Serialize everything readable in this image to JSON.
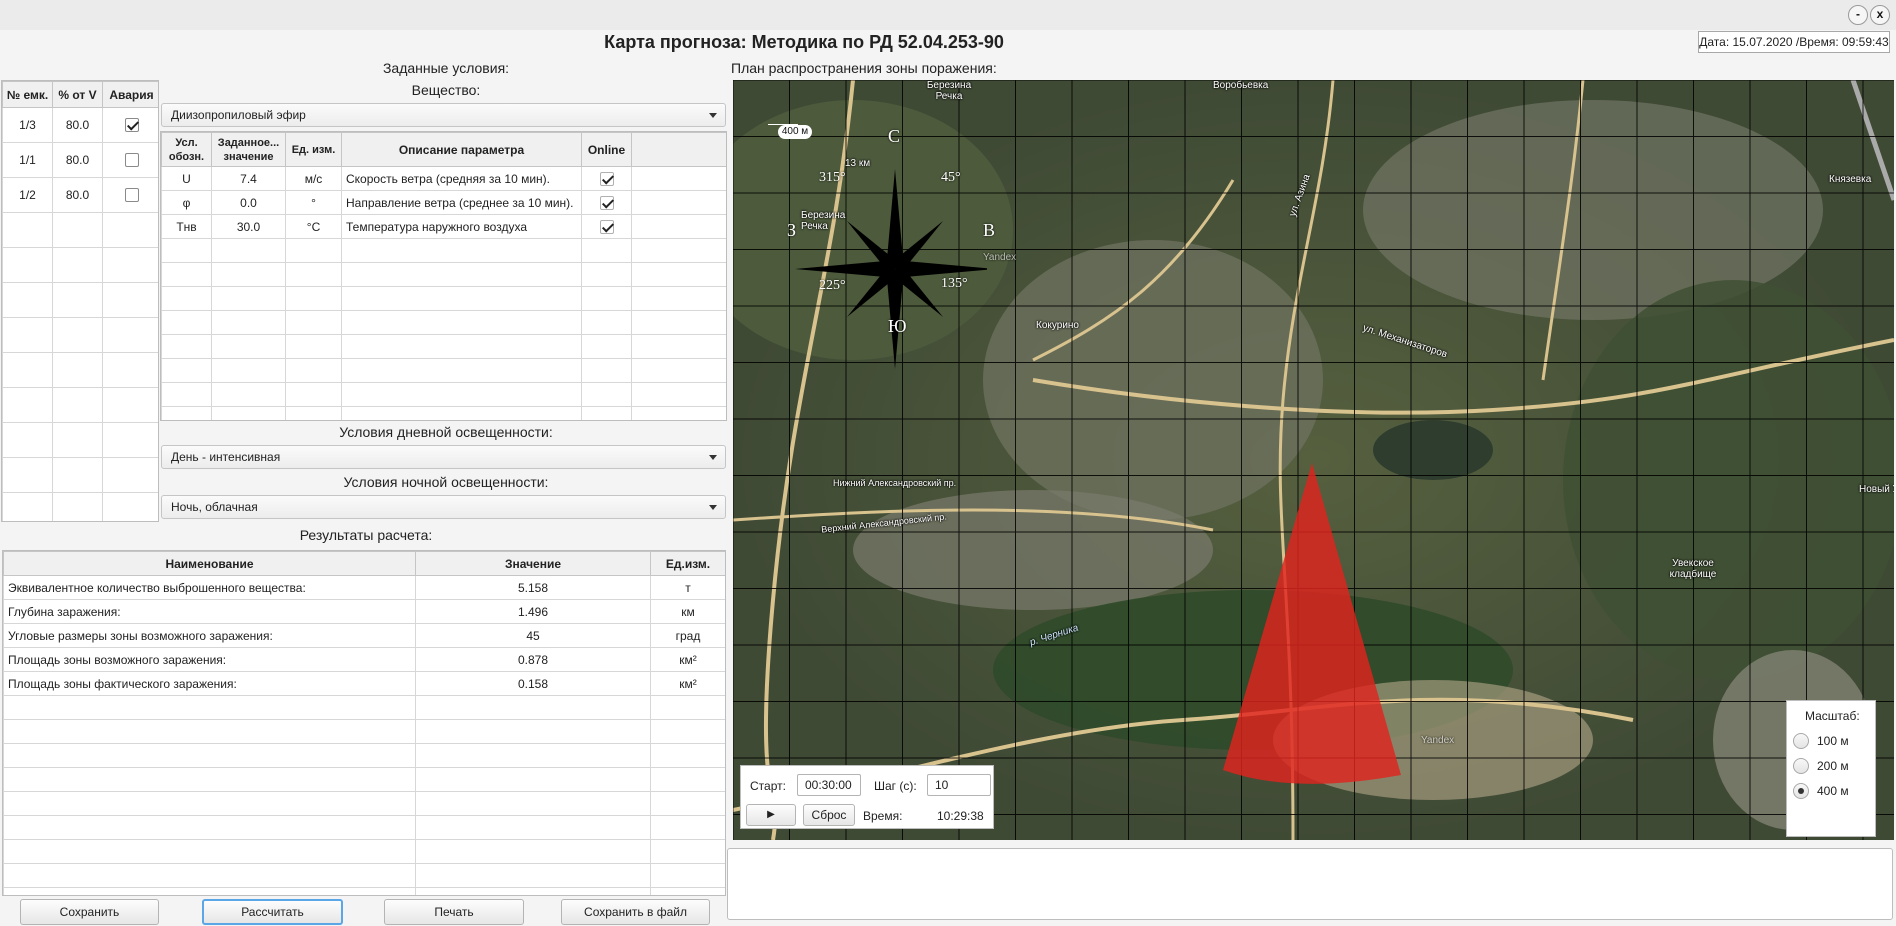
{
  "window": {
    "title": "Карта прогноза: Методика по РД 52.04.253-90",
    "minimize": "-",
    "close": "x",
    "datetime": "Дата: 15.07.2020 /Время: 09:59:43"
  },
  "tanks": {
    "headers": [
      "№ емк.",
      "% от V",
      "Авария"
    ],
    "rows": [
      {
        "num": "1/3",
        "pct": "80.0",
        "accident": true
      },
      {
        "num": "1/1",
        "pct": "80.0",
        "accident": false
      },
      {
        "num": "1/2",
        "pct": "80.0",
        "accident": false
      }
    ]
  },
  "conditions": {
    "title": "Заданные условия:",
    "substance_label": "Вещество:",
    "substance_value": "Диизопропиловый эфир",
    "params_headers": [
      "Усл. обозн.",
      "Заданное... значение",
      "Ед. изм.",
      "Описание параметра",
      "Online"
    ],
    "params": [
      {
        "sym": "U",
        "val": "7.4",
        "unit": "м/с",
        "desc": "Скорость ветра (средняя за 10 мин).",
        "online": true
      },
      {
        "sym": "φ",
        "val": "0.0",
        "unit": "°",
        "desc": "Направление ветра (среднее за 10 мин).",
        "online": true
      },
      {
        "sym": "Тнв",
        "val": "30.0",
        "unit": "°С",
        "desc": "Температура наружного воздуха",
        "online": true
      }
    ],
    "day_label": "Условия дневной освещенности:",
    "day_value": "День - интенсивная",
    "night_label": "Условия ночной освещенности:",
    "night_value": "Ночь, облачная"
  },
  "results": {
    "title": "Результаты расчета:",
    "headers": [
      "Наименование",
      "Значение",
      "Ед.изм."
    ],
    "rows": [
      {
        "name": "Эквивалентное количество выброшенного вещества:",
        "value": "5.158",
        "unit": "т"
      },
      {
        "name": "Глубина заражения:",
        "value": "1.496",
        "unit": "км"
      },
      {
        "name": "Угловые размеры зоны возможного заражения:",
        "value": "45",
        "unit": "град"
      },
      {
        "name": "Площадь зоны возможного заражения:",
        "value": "0.878",
        "unit": "км²"
      },
      {
        "name": "Площадь зоны фактического заражения:",
        "value": "0.158",
        "unit": "км²"
      }
    ]
  },
  "buttons": {
    "save": "Сохранить",
    "calculate": "Рассчитать",
    "print": "Печать",
    "save_file": "Сохранить в файл"
  },
  "map": {
    "title": "План распространения зоны поражения:",
    "scale_bar": "400 м",
    "compass": {
      "n": "С",
      "s": "Ю",
      "e": "В",
      "w": "З",
      "ne": "45°",
      "se": "135°",
      "sw": "225°",
      "nw": "315°"
    },
    "places": [
      "Березина Речка",
      "13 км",
      "Березина Речка",
      "Кокурино",
      "Воробьевка",
      "Нижний Александровский пр.",
      "Верхний Александровский пр.",
      "ул. Механизаторов",
      "р. Черника",
      "Увекское кладбище",
      "Князевка",
      "Новый Увек",
      "ул. Азина",
      "Yandex",
      "Yandex"
    ],
    "playback": {
      "start_label": "Старт:",
      "start_value": "00:30:00",
      "step_label": "Шаг (с):",
      "step_value": "10",
      "play": "▶",
      "reset": "Сброс",
      "time_label": "Время:",
      "time_value": "10:29:38"
    },
    "scale": {
      "title": "Масштаб:",
      "options": [
        "100 м",
        "200 м",
        "400 м"
      ],
      "selected": "400 м"
    }
  },
  "colors": {
    "zone": "#e0231d",
    "accent": "#5aa6e6"
  }
}
